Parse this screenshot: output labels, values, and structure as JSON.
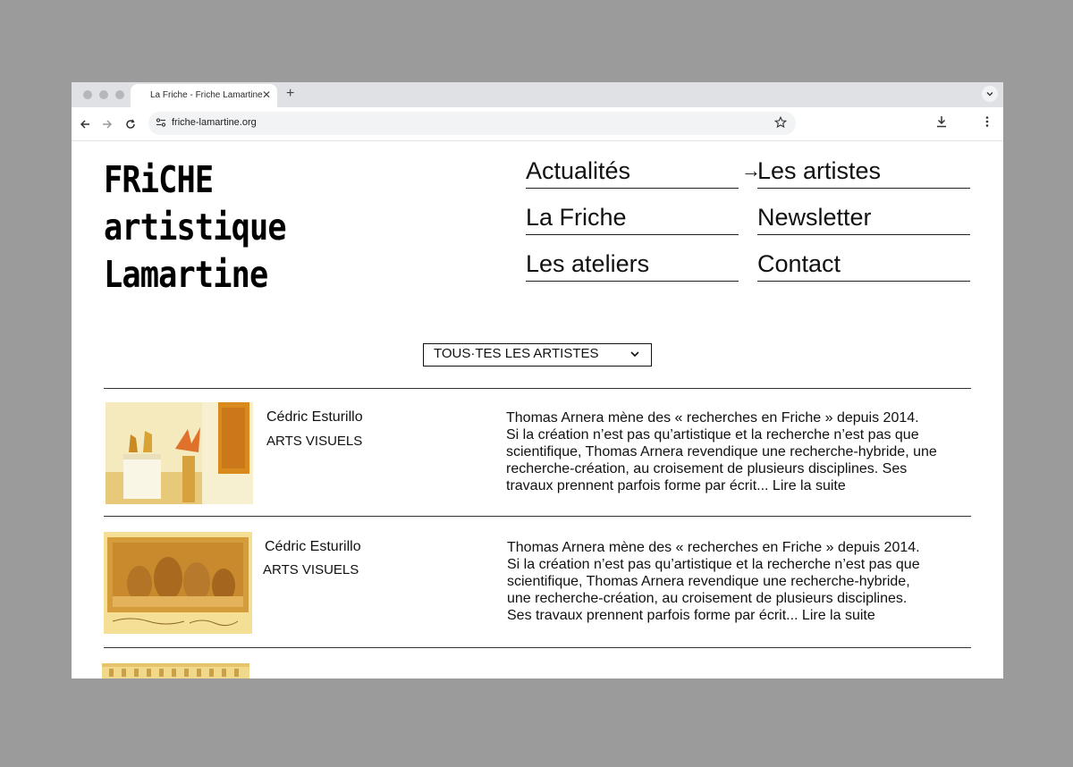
{
  "browser": {
    "tab_title": "La Friche - Friche Lamartine",
    "new_tab_symbol": "+",
    "close_symbol": "✕",
    "url": "friche-lamartine.org"
  },
  "site": {
    "logo_lines": [
      "FRiCHE",
      "artistique",
      "Lamartine"
    ],
    "nav": [
      {
        "label": "Actualités",
        "active": false
      },
      {
        "label": "Les artistes",
        "active": true
      },
      {
        "label": "La Friche",
        "active": false
      },
      {
        "label": "Newsletter",
        "active": false
      },
      {
        "label": "Les ateliers",
        "active": false
      },
      {
        "label": "Contact",
        "active": false
      }
    ],
    "active_arrow": "→",
    "filter_label": "TOUS·TES LES ARTISTES",
    "artists": [
      {
        "name": "Cédric Esturillo",
        "category": "ARTS VISUELS",
        "bio_lines": [
          "Thomas Arnera mène des « recherches en Friche » depuis 2014.",
          "Si la création n’est pas qu’artistique et la recherche n’est pas que",
          "scientifique, Thomas Arnera revendique une recherche-hybride, une",
          "recherche-création, au croisement de plusieurs disciplines. Ses",
          "travaux prennent parfois forme par écrit... Lire la suite"
        ]
      },
      {
        "name": "Cédric Esturillo",
        "category": "ARTS VISUELS",
        "bio_lines": [
          "Thomas Arnera mène des « recherches en Friche » depuis 2014.",
          "Si la création n’est pas qu’artistique et la recherche n’est pas que",
          "scientifique, Thomas Arnera revendique une recherche-hybride,",
          "une recherche-création, au croisement de plusieurs disciplines.",
          "Ses travaux prennent parfois forme par écrit... Lire la suite"
        ]
      }
    ]
  },
  "colors": {
    "window_bg": "#9b9b9b",
    "tabstrip": "#dfe1e5",
    "thumb_tint": "#f1c24a"
  }
}
